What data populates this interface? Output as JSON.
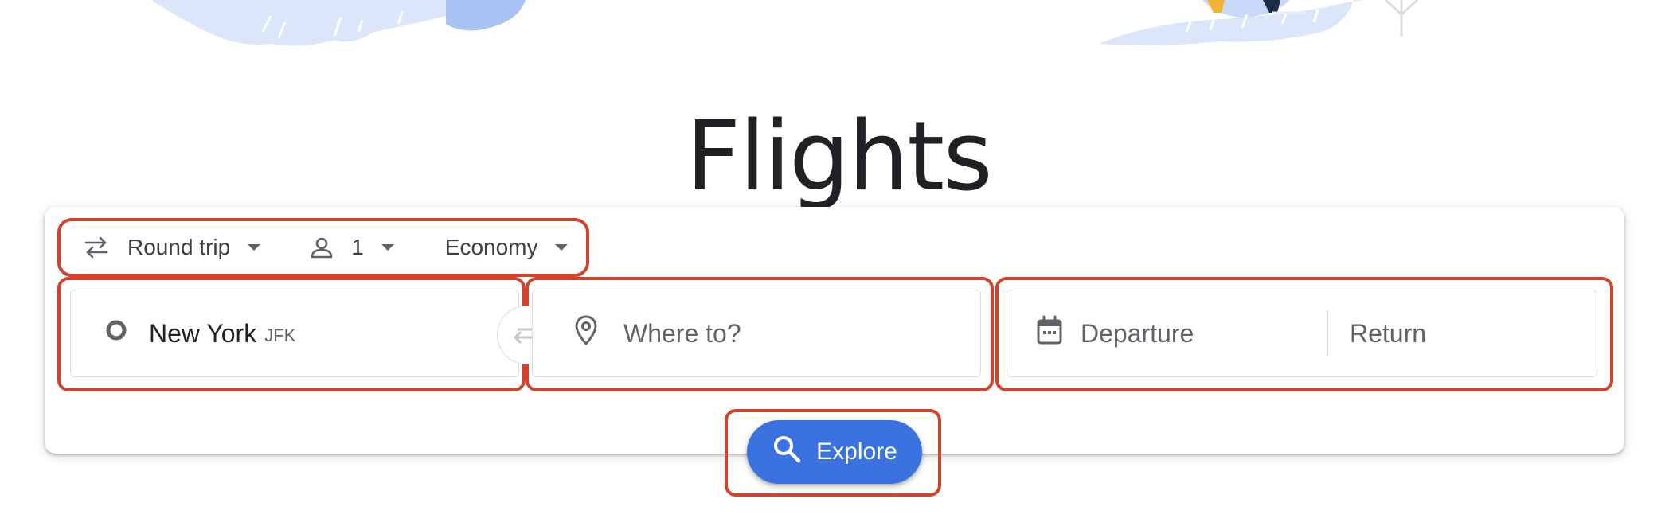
{
  "page": {
    "title": "Flights"
  },
  "trip_options": {
    "trip_type": "Round trip",
    "passengers": "1",
    "cabin_class": "Economy"
  },
  "origin": {
    "city": "New York",
    "code": "JFK"
  },
  "destination": {
    "placeholder": "Where to?"
  },
  "dates": {
    "departure_placeholder": "Departure",
    "return_placeholder": "Return"
  },
  "actions": {
    "explore_label": "Explore"
  },
  "colors": {
    "accent": "#3a72e0",
    "highlight": "#d3432b",
    "border": "#dadce0",
    "text": "#3c4043"
  },
  "icons": {
    "trip_type": "swap-arrows-icon",
    "passengers": "person-icon",
    "origin": "hollow-circle-icon",
    "swap": "swap-icon",
    "destination": "location-pin-icon",
    "dates": "calendar-icon",
    "search": "search-icon"
  }
}
